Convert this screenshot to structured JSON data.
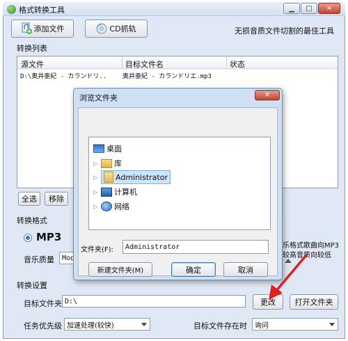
{
  "window": {
    "title": "格式转换工具"
  },
  "toolbar": {
    "add_file": "添加文件",
    "cd_rip": "CD抓轨",
    "slogan": "无损音质文件切割的最佳工具"
  },
  "convert_list": {
    "title": "转换列表",
    "headers": [
      "源文件",
      "目标文件名",
      "状态"
    ],
    "rows": [
      {
        "source": "D:\\奥井亜紀 - カランドリ..",
        "target": "奥井亜紀 - カランドリエ.mp3",
        "status": ""
      }
    ]
  },
  "list_buttons": {
    "select_all": "全选",
    "remove": "移除"
  },
  "format": {
    "title": "转换格式",
    "selected": "MP3",
    "quality_label": "音乐质量",
    "quality_value": "Mod",
    "desc_line1": "乐格式歌曲向MP3",
    "desc_line2": "较高音质向较低"
  },
  "settings": {
    "title": "转换设置",
    "target_folder_label": "目标文件夹",
    "target_folder_value": "D:\\",
    "change_button": "更改",
    "open_folder_button": "打开文件夹",
    "priority_label": "任务优先级",
    "priority_value": "加速处理(较快)",
    "exists_label": "目标文件存在时",
    "exists_value": "询问"
  },
  "dialog": {
    "title": "浏览文件夹",
    "tree": [
      {
        "label": "桌面",
        "icon": "desktop-icon",
        "expandable": false
      },
      {
        "label": "库",
        "icon": "library-icon",
        "expandable": true
      },
      {
        "label": "Administrator",
        "icon": "user-folder-icon",
        "expandable": true,
        "selected": true
      },
      {
        "label": "计算机",
        "icon": "computer-icon",
        "expandable": true
      },
      {
        "label": "网络",
        "icon": "network-icon",
        "expandable": true
      }
    ],
    "folder_label": "文件夹(F):",
    "folder_value": "Administrator",
    "new_folder": "新建文件夹(M)",
    "ok": "确定",
    "cancel": "取消"
  },
  "colors": {
    "accent": "#3399ff",
    "annotation_arrow": "#e02020"
  }
}
